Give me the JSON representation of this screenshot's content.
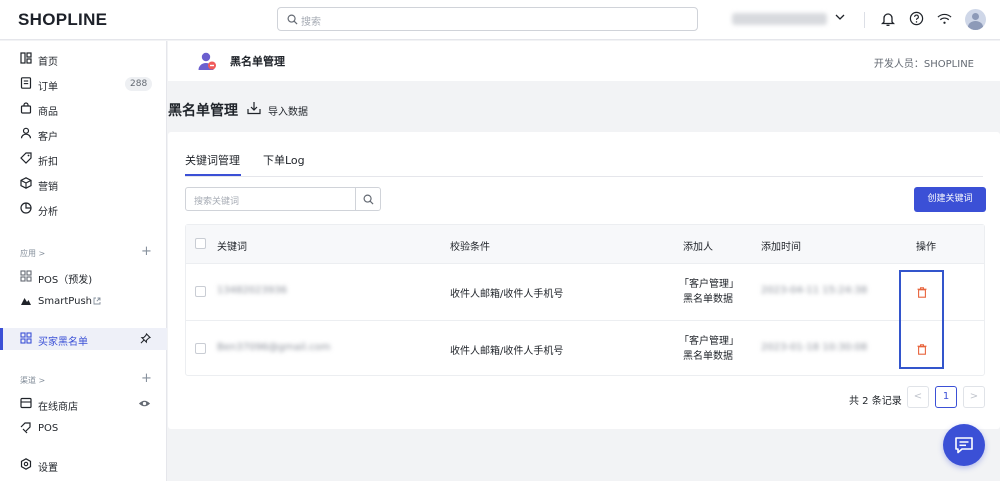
{
  "topbar": {
    "logo": "SHOPLINE",
    "search_placeholder": "搜索"
  },
  "sidebar": {
    "items": [
      {
        "label": "首页",
        "icon": "home-icon"
      },
      {
        "label": "订单",
        "icon": "order-icon",
        "badge": "288"
      },
      {
        "label": "商品",
        "icon": "bag-icon"
      },
      {
        "label": "客户",
        "icon": "user-icon"
      },
      {
        "label": "折扣",
        "icon": "tag-icon"
      },
      {
        "label": "营销",
        "icon": "box-icon"
      },
      {
        "label": "分析",
        "icon": "chart-pie-icon"
      }
    ],
    "apps_section": "应用 >",
    "apps": [
      {
        "label": "POS（预发)",
        "icon": "grid-icon"
      },
      {
        "label": "SmartPush",
        "icon": "smartpush-icon"
      }
    ],
    "active_app": {
      "label": "买家黑名单",
      "icon": "grid-icon"
    },
    "channels_section": "渠道 >",
    "channels": [
      {
        "label": "在线商店",
        "icon": "store-icon"
      },
      {
        "label": "POS",
        "icon": "pos-icon"
      }
    ],
    "settings": {
      "label": "设置",
      "icon": "settings-icon"
    }
  },
  "page_header": {
    "app_title": "黑名单管理",
    "developer": "开发人员：SHOPLINE"
  },
  "page": {
    "title": "黑名单管理",
    "import_label": "导入数据"
  },
  "tabs": [
    {
      "label": "关键词管理",
      "active": true
    },
    {
      "label": "下单Log",
      "active": false
    }
  ],
  "keyword_search": {
    "placeholder": "搜索关键词"
  },
  "create_button": "创建关键词",
  "table": {
    "columns": [
      "关键词",
      "校验条件",
      "添加人",
      "添加时间",
      "操作"
    ],
    "rows": [
      {
        "keyword": "13482023936",
        "condition": "收件人邮箱/收件人手机号",
        "adder_line1": "「客户管理」",
        "adder_line2": "黑名单数据",
        "time": "2023-04-11 15:24:38"
      },
      {
        "keyword": "Ben37096@gmail.com",
        "condition": "收件人邮箱/收件人手机号",
        "adder_line1": "「客户管理」",
        "adder_line2": "黑名单数据",
        "time": "2023-01-18 10:30:08"
      }
    ]
  },
  "pagination": {
    "total_text": "共 2 条记录",
    "current_page": "1",
    "prev": "<",
    "next": ">"
  },
  "colors": {
    "accent": "#3b50d6",
    "highlight": "#3355cc",
    "delete": "#e8643c"
  }
}
